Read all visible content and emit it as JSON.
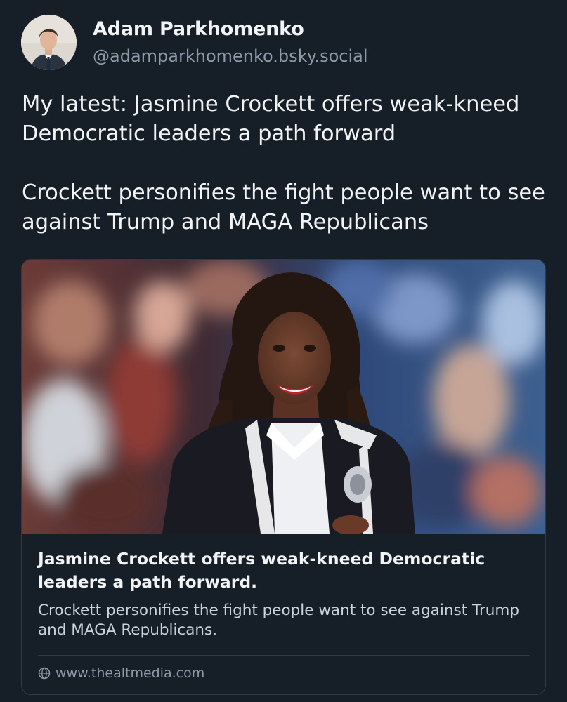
{
  "author": {
    "name": "Adam Parkhomenko",
    "handle": "@adamparkhomenko.bsky.social"
  },
  "post": {
    "paragraphs": [
      "My latest: Jasmine Crockett offers weak-kneed Democratic leaders a path forward",
      "Crockett personifies the fight people want to see against Trump and MAGA Republicans"
    ]
  },
  "link_card": {
    "title": "Jasmine Crockett offers weak-kneed Democratic leaders a path forward.",
    "description": "Crockett personifies the fight people want to see against Trump and MAGA Republicans.",
    "domain": "www.thealtmedia.com",
    "domain_icon": "globe-icon"
  },
  "colors": {
    "background": "#161e27",
    "primary_text": "#f1f3f5",
    "secondary_text": "#8e9aa8",
    "card_border": "#2e3a48"
  }
}
